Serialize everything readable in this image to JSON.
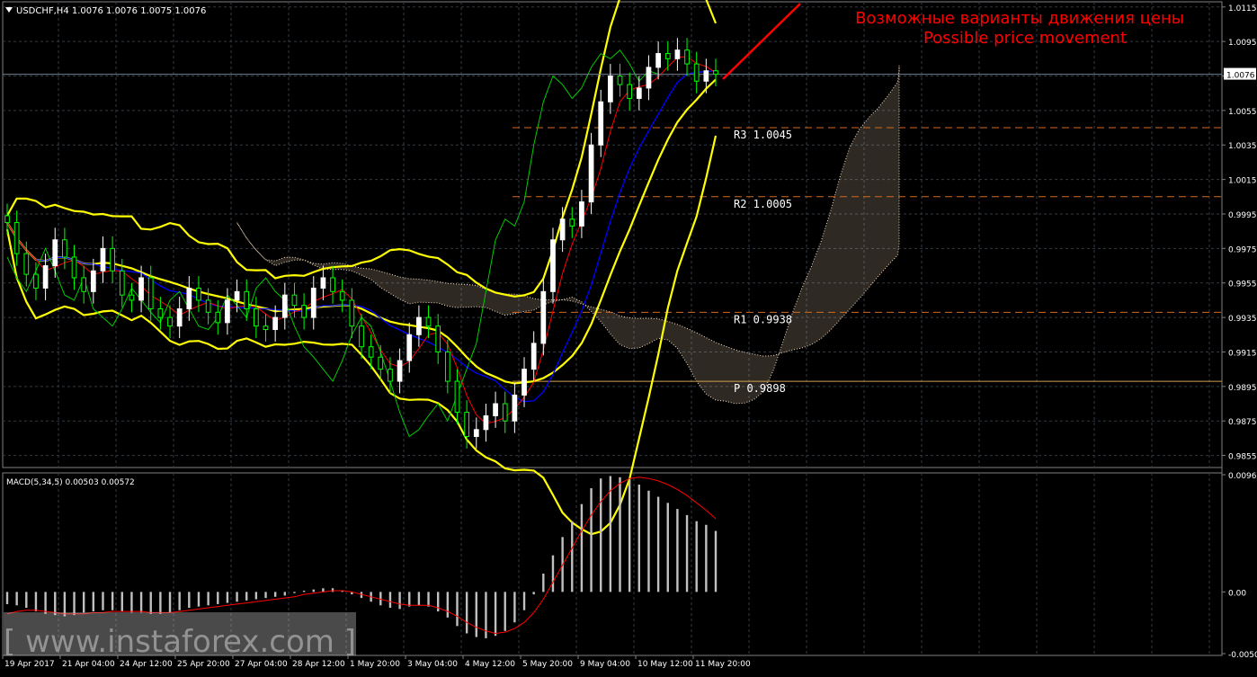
{
  "header": {
    "symbol_label": "USDCHF,H4  1.0076 1.0076 1.0075 1.0076"
  },
  "annotation": {
    "line_ru": "Возможные варианты движения цены",
    "line_en": "Possible price movement",
    "color": "#ff0000"
  },
  "watermark": {
    "text": "[ www.instaforex.com ]"
  },
  "macd_label": "MACD(5,34,5) 0.00503 0.00572",
  "colors": {
    "background": "#000000",
    "grid": "#2f3b47",
    "bull_candle": "#ffffff",
    "bear_candle": "#00ff00",
    "bollinger": "#ffff00",
    "kijun": "#0000ff",
    "tenkan": "#ff0000",
    "chikou": "#00cc00",
    "cloud": "#ffe4c4",
    "pivot_lines": "#d2691e",
    "macd_hist": "#c0c0c0",
    "macd_signal": "#ff0000",
    "axis_text": "#ffffff"
  },
  "chart_data": [
    {
      "type": "line",
      "title": "USDCHF,H4",
      "ylim": [
        0.9848,
        1.0118
      ],
      "y_ticks": [
        "1.0115",
        "1.0095",
        "1.0075",
        "1.0055",
        "1.0035",
        "1.0015",
        "0.9995",
        "0.9975",
        "0.9955",
        "0.9935",
        "0.9915",
        "0.9895",
        "0.9875",
        "0.9855"
      ],
      "current_price": "1.0076",
      "x_ticks": [
        "19 Apr 2017",
        "21 Apr 04:00",
        "24 Apr 12:00",
        "25 Apr 20:00",
        "27 Apr 04:00",
        "28 Apr 12:00",
        "1 May 20:00",
        "3 May 04:00",
        "4 May 12:00",
        "5 May 20:00",
        "9 May 04:00",
        "10 May 12:00",
        "11 May 20:00"
      ],
      "levels": [
        {
          "label": "R3",
          "value": "1.0045"
        },
        {
          "label": "R2",
          "value": "1.0005"
        },
        {
          "label": "R1",
          "value": "0.9938"
        },
        {
          "label": "P",
          "value": "0.9898"
        }
      ],
      "close_series": [
        0.999,
        0.9972,
        0.996,
        0.9952,
        0.9965,
        0.998,
        0.997,
        0.9958,
        0.995,
        0.9962,
        0.9975,
        0.9962,
        0.9948,
        0.9945,
        0.9958,
        0.994,
        0.9935,
        0.993,
        0.994,
        0.9952,
        0.9945,
        0.9938,
        0.9932,
        0.9945,
        0.995,
        0.994,
        0.993,
        0.9928,
        0.9935,
        0.9948,
        0.9942,
        0.9935,
        0.9952,
        0.9958,
        0.995,
        0.9945,
        0.993,
        0.9918,
        0.9912,
        0.9905,
        0.9898,
        0.991,
        0.9925,
        0.9935,
        0.993,
        0.9915,
        0.9898,
        0.988,
        0.9866,
        0.987,
        0.9878,
        0.9885,
        0.9875,
        0.989,
        0.9905,
        0.992,
        0.995,
        0.998,
        0.9992,
        0.9988,
        1.0002,
        1.0035,
        1.006,
        1.0075,
        1.007,
        1.0062,
        1.0068,
        1.008,
        1.0088,
        1.0085,
        1.009,
        1.0082,
        1.0072,
        1.0078,
        1.0076
      ],
      "macd": {
        "ylim": [
          -0.00506,
          0.00961
        ],
        "y_ticks": [
          "0.00961",
          "0.00",
          "-0.00506"
        ],
        "histogram": [
          -0.001,
          -0.0011,
          -0.0013,
          -0.0016,
          -0.0018,
          -0.0019,
          -0.002,
          -0.0019,
          -0.0017,
          -0.0016,
          -0.0015,
          -0.0015,
          -0.0016,
          -0.0017,
          -0.0017,
          -0.0018,
          -0.0018,
          -0.0017,
          -0.0015,
          -0.0013,
          -0.0012,
          -0.0011,
          -0.001,
          -0.0009,
          -0.0008,
          -0.0007,
          -0.0006,
          -0.0005,
          -0.0004,
          -0.0003,
          -0.0001,
          0.0001,
          0.0002,
          0.0003,
          0.0003,
          0.0001,
          -0.0002,
          -0.0005,
          -0.0008,
          -0.0011,
          -0.0013,
          -0.0014,
          -0.0012,
          -0.0011,
          -0.0012,
          -0.0016,
          -0.0021,
          -0.0028,
          -0.0034,
          -0.0037,
          -0.0038,
          -0.0036,
          -0.0032,
          -0.0025,
          -0.0015,
          -0.0002,
          0.0015,
          0.003,
          0.0045,
          0.0058,
          0.0072,
          0.0085,
          0.0093,
          0.0095,
          0.0094,
          0.0092,
          0.0088,
          0.0083,
          0.0078,
          0.0073,
          0.0068,
          0.0063,
          0.0058,
          0.0055,
          0.005
        ],
        "signal": [
          -0.0018,
          -0.0016,
          -0.0015,
          -0.0015,
          -0.0016,
          -0.0017,
          -0.0018,
          -0.0018,
          -0.0018,
          -0.0017,
          -0.0017,
          -0.0016,
          -0.0016,
          -0.0016,
          -0.0016,
          -0.0017,
          -0.0017,
          -0.0017,
          -0.0016,
          -0.0015,
          -0.0014,
          -0.0013,
          -0.0012,
          -0.0011,
          -0.001,
          -0.0009,
          -0.0008,
          -0.0007,
          -0.0006,
          -0.0005,
          -0.0004,
          -0.0002,
          -0.0001,
          0.0,
          0.0001,
          0.0001,
          0.0,
          -0.0002,
          -0.0004,
          -0.0006,
          -0.0008,
          -0.001,
          -0.0011,
          -0.0011,
          -0.0011,
          -0.0013,
          -0.0016,
          -0.002,
          -0.0025,
          -0.0029,
          -0.0032,
          -0.0034,
          -0.0033,
          -0.003,
          -0.0025,
          -0.0017,
          -0.0006,
          0.0008,
          0.0022,
          0.0036,
          0.005,
          0.0063,
          0.0074,
          0.0083,
          0.0089,
          0.0093,
          0.0094,
          0.0093,
          0.0091,
          0.0088,
          0.0084,
          0.0079,
          0.0073,
          0.0067,
          0.006
        ]
      }
    }
  ]
}
